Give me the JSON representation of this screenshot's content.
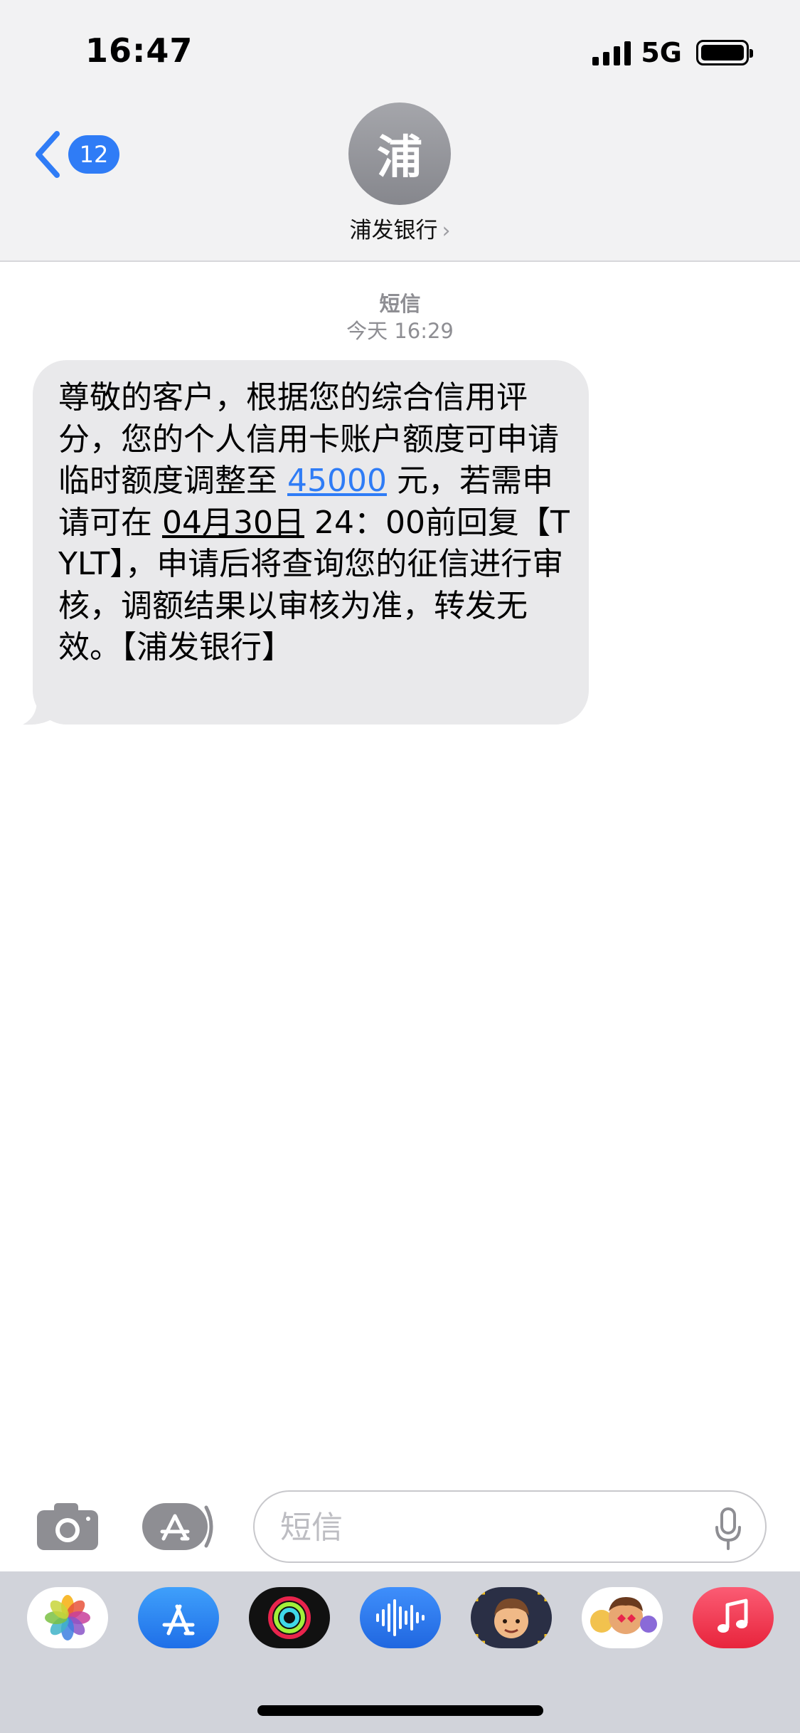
{
  "status_bar": {
    "time": "16:47",
    "network": "5G"
  },
  "header": {
    "back_badge": "12",
    "avatar_letter": "浦",
    "contact_name": "浦发银行",
    "contact_chevron": "›"
  },
  "thread": {
    "message_type": "短信",
    "timestamp": "今天 16:29",
    "message": {
      "part1": "尊敬的客户，根据您的综合信用评分，您的个人信用卡账户额度可申请临时额度调整至 ",
      "amount_link": "45000",
      "part2": " 元，若需申请可在 ",
      "date_link": "04月30日",
      "part3": " 24：00前回复【TYLT】，申请后将查询您的征信进行审核，调额结果以审核为准，转发无效。【浦发银行】"
    }
  },
  "input_bar": {
    "placeholder": "短信"
  },
  "app_drawer": {
    "apps": [
      "photos-icon",
      "app-store-icon",
      "fitness-icon",
      "audio-message-icon",
      "memoji-icon",
      "animoji-stickers-icon",
      "music-icon"
    ]
  },
  "colors": {
    "accent": "#2f7cf6",
    "bubble": "#e9e9eb",
    "header_bg": "#f2f2f3",
    "drawer_bg": "#d1d3da"
  }
}
